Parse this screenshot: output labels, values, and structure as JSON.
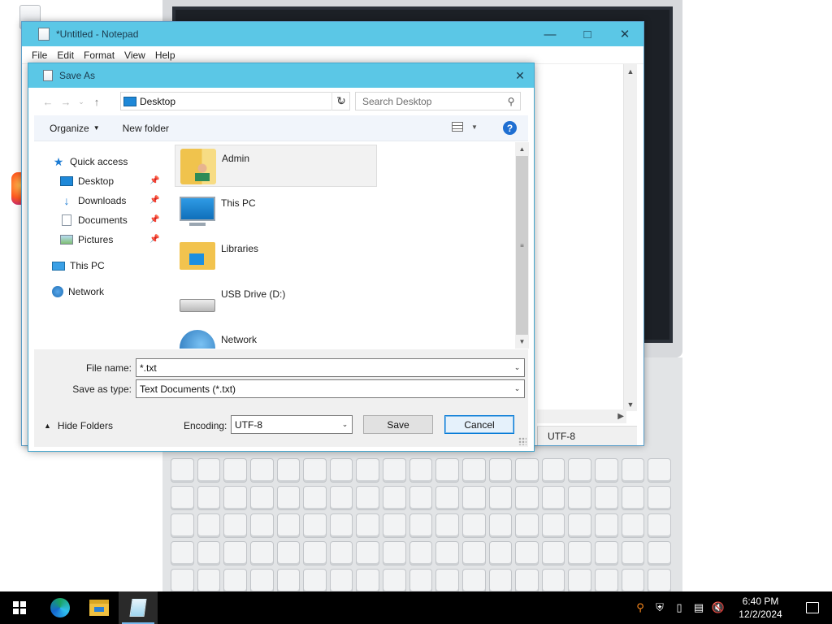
{
  "notepad": {
    "title": "*Untitled - Notepad",
    "menu": [
      "File",
      "Edit",
      "Format",
      "View",
      "Help"
    ],
    "status_encoding": "UTF-8"
  },
  "dialog": {
    "title": "Save As",
    "address": "Desktop",
    "search_placeholder": "Search Desktop",
    "organize_label": "Organize",
    "new_folder_label": "New folder",
    "help_label": "?",
    "nav": {
      "quick_access": "Quick access",
      "desktop": "Desktop",
      "downloads": "Downloads",
      "documents": "Documents",
      "pictures": "Pictures",
      "this_pc": "This PC",
      "network": "Network"
    },
    "files": [
      {
        "name": "Admin",
        "icon": "user-folder-icon",
        "selected": true
      },
      {
        "name": "This PC",
        "icon": "computer-icon",
        "selected": false
      },
      {
        "name": "Libraries",
        "icon": "libraries-icon",
        "selected": false
      },
      {
        "name": "USB Drive (D:)",
        "icon": "usb-drive-icon",
        "selected": false
      },
      {
        "name": "Network",
        "icon": "network-icon",
        "selected": false
      }
    ],
    "file_name_label": "File name:",
    "file_name_value": "*.txt",
    "save_type_label": "Save as type:",
    "save_type_value": "Text Documents (*.txt)",
    "hide_folders_label": "Hide Folders",
    "encoding_label": "Encoding:",
    "encoding_value": "UTF-8",
    "save_label": "Save",
    "cancel_label": "Cancel"
  },
  "taskbar": {
    "time": "6:40 PM",
    "date": "12/2/2024",
    "apps": [
      "start",
      "edge",
      "file-explorer",
      "notepad"
    ],
    "active_app": "notepad"
  },
  "colors": {
    "titlebar": "#5bc7e6",
    "accent": "#0078d7",
    "taskbar": "#000000"
  }
}
